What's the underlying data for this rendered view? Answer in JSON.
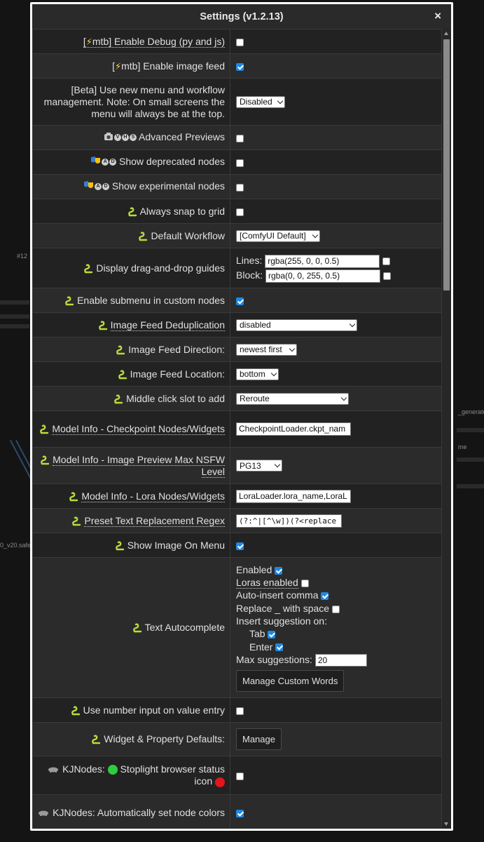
{
  "background": {
    "node_label_1": "#12",
    "node_label_2": "_generate",
    "node_label_3": "me",
    "node_label_4": "0_v20.safet"
  },
  "dialog": {
    "title": "Settings (v1.2.13)",
    "close_label": "×"
  },
  "rows": {
    "debug": {
      "pre": "[",
      "label": "mtb] Enable Debug (py and js)",
      "checked": false
    },
    "image_feed": {
      "pre": "[",
      "label": "mtb] Enable image feed",
      "checked": true
    },
    "beta_menu": {
      "label": "[Beta] Use new menu and workflow management. Note: On small screens the menu will always be at the top.",
      "value": "Disabled"
    },
    "advanced_previews": {
      "badges": "VHS",
      "label": "Advanced Previews",
      "checked": false
    },
    "deprecated": {
      "badges": "AD",
      "label": "Show deprecated nodes",
      "checked": false
    },
    "experimental": {
      "badges": "AD",
      "label": "Show experimental nodes",
      "checked": false
    },
    "snap_grid": {
      "label": "Always snap to grid",
      "checked": false
    },
    "default_workflow": {
      "label": "Default Workflow",
      "value": "[ComfyUI Default]"
    },
    "dnd_guides": {
      "label": "Display drag-and-drop guides",
      "lines_label": "Lines:",
      "lines_value": "rgba(255, 0, 0, 0.5)",
      "block_label": "Block:",
      "block_value": "rgba(0, 0, 255, 0.5)"
    },
    "submenu": {
      "label": "Enable submenu in custom nodes",
      "checked": true
    },
    "dedup": {
      "label": "Image Feed Deduplication",
      "value": "disabled"
    },
    "direction": {
      "label": "Image Feed Direction:",
      "value": "newest first"
    },
    "location": {
      "label": "Image Feed Location:",
      "value": "bottom"
    },
    "middle_click": {
      "label": "Middle click slot to add",
      "value": "Reroute"
    },
    "model_ckpt": {
      "label": "Model Info - Checkpoint Nodes/Widgets",
      "value": "CheckpointLoader.ckpt_nam"
    },
    "model_nsfw": {
      "label": "Model Info - Image Preview Max NSFW Level",
      "value": "PG13"
    },
    "model_lora": {
      "label": "Model Info - Lora Nodes/Widgets",
      "value": "LoraLoader.lora_name,LoraL"
    },
    "preset_regex": {
      "label": "Preset Text Replacement Regex",
      "value": "(?:^|[^\\w])(?<replace"
    },
    "image_menu": {
      "label": "Show Image On Menu",
      "checked": true
    },
    "autocomplete": {
      "label": "Text Autocomplete",
      "enabled": "Enabled",
      "loras": "Loras enabled",
      "comma": "Auto-insert comma",
      "replace": "Replace _ with space",
      "insert_on": "Insert suggestion on:",
      "tab": "Tab",
      "enter": "Enter",
      "max_label": "Max suggestions:",
      "max_value": "20",
      "manage_words": "Manage Custom Words"
    },
    "number_input": {
      "label": "Use number input on value entry",
      "checked": false
    },
    "widget_defaults": {
      "label": "Widget & Property Defaults:",
      "button": "Manage"
    },
    "stoplight": {
      "prefix": "KJNodes:",
      "label": "Stoplight browser status icon"
    },
    "node_colors": {
      "label": "KJNodes: Automatically set node colors",
      "checked": true
    }
  },
  "colors": {
    "accent": "#1e88e5",
    "snake": "#b8dc3c",
    "green_light": "#2ecc40",
    "red_light": "#e3161b"
  }
}
